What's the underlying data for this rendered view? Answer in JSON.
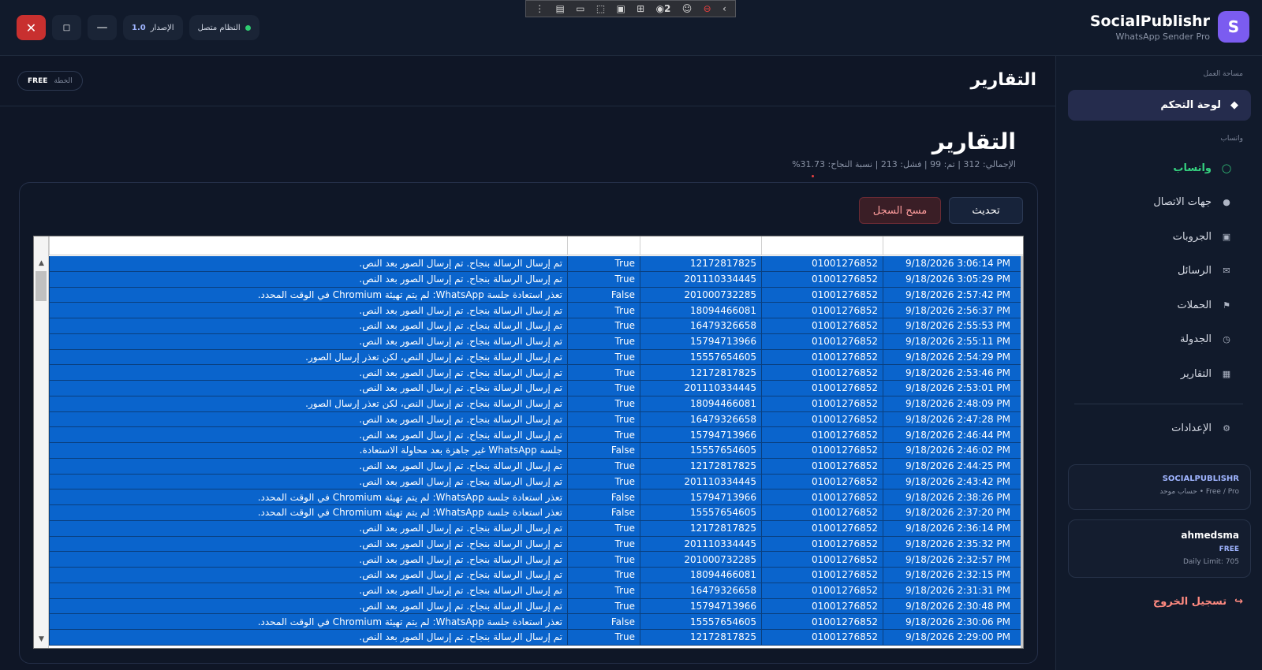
{
  "window": {
    "brand": {
      "logo_letter": "S",
      "name": "SocialPublishr",
      "subtitle": "WhatsApp Sender Pro"
    },
    "status_pill": "النظام متصل",
    "version_label": "الإصدار",
    "version_value": "1.0",
    "close_glyph": "✕",
    "maximize_glyph": "□",
    "minimize_glyph": "—"
  },
  "devtools": {
    "record_count": "2"
  },
  "sidebar": {
    "workspace_label": "مساحة العمل",
    "dashboard": "لوحة التحكم",
    "whatsapp_label": "واتساب",
    "items": [
      {
        "label": "واتساب",
        "icon": "chat-bubble-icon"
      },
      {
        "label": "جهات الاتصال",
        "icon": "info-circle-icon"
      },
      {
        "label": "الجروبات",
        "icon": "group-card-icon"
      },
      {
        "label": "الرسائل",
        "icon": "mail-icon"
      },
      {
        "label": "الحملات",
        "icon": "flag-icon"
      },
      {
        "label": "الجدولة",
        "icon": "clock-icon"
      },
      {
        "label": "التقارير",
        "icon": "bar-chart-icon"
      }
    ],
    "settings": "الإعدادات",
    "account_card": {
      "title": "SOCIALPUBLISHR",
      "subtitle": "حساب موحد • Free / Pro"
    },
    "user_card": {
      "username": "ahmedsma",
      "plan": "FREE",
      "limit": "Daily Limit: 705"
    },
    "logout": "تسجيل الخروج"
  },
  "header": {
    "title": "التقارير",
    "plan_label": "الخطة",
    "plan_value": "FREE"
  },
  "main": {
    "title": "التقارير",
    "summary": "الإجمالي: 312 | تم: 99 | فشل: 213 | نسبة النجاح: 31.73%",
    "refresh_button": "تحديث",
    "clear_button": "مسح السجل"
  },
  "log_rows": [
    {
      "date": "9/18/2026 3:06:14 PM",
      "sender": "01001276852",
      "receiver": "12172817825",
      "success": "True",
      "message": "تم إرسال الرسالة بنجاح. تم إرسال الصور بعد النص."
    },
    {
      "date": "9/18/2026 3:05:29 PM",
      "sender": "01001276852",
      "receiver": "201110334445",
      "success": "True",
      "message": "تم إرسال الرسالة بنجاح. تم إرسال الصور بعد النص."
    },
    {
      "date": "9/18/2026 2:57:42 PM",
      "sender": "01001276852",
      "receiver": "201000732285",
      "success": "False",
      "message": "تعذر استعادة جلسة WhatsApp: لم يتم تهيئة Chromium في الوقت المحدد."
    },
    {
      "date": "9/18/2026 2:56:37 PM",
      "sender": "01001276852",
      "receiver": "18094466081",
      "success": "True",
      "message": "تم إرسال الرسالة بنجاح. تم إرسال الصور بعد النص."
    },
    {
      "date": "9/18/2026 2:55:53 PM",
      "sender": "01001276852",
      "receiver": "16479326658",
      "success": "True",
      "message": "تم إرسال الرسالة بنجاح. تم إرسال الصور بعد النص."
    },
    {
      "date": "9/18/2026 2:55:11 PM",
      "sender": "01001276852",
      "receiver": "15794713966",
      "success": "True",
      "message": "تم إرسال الرسالة بنجاح. تم إرسال الصور بعد النص."
    },
    {
      "date": "9/18/2026 2:54:29 PM",
      "sender": "01001276852",
      "receiver": "15557654605",
      "success": "True",
      "message": "تم إرسال الرسالة بنجاح. تم إرسال النص، لكن تعذر إرسال الصور."
    },
    {
      "date": "9/18/2026 2:53:46 PM",
      "sender": "01001276852",
      "receiver": "12172817825",
      "success": "True",
      "message": "تم إرسال الرسالة بنجاح. تم إرسال الصور بعد النص."
    },
    {
      "date": "9/18/2026 2:53:01 PM",
      "sender": "01001276852",
      "receiver": "201110334445",
      "success": "True",
      "message": "تم إرسال الرسالة بنجاح. تم إرسال الصور بعد النص."
    },
    {
      "date": "9/18/2026 2:48:09 PM",
      "sender": "01001276852",
      "receiver": "18094466081",
      "success": "True",
      "message": "تم إرسال الرسالة بنجاح. تم إرسال النص، لكن تعذر إرسال الصور."
    },
    {
      "date": "9/18/2026 2:47:28 PM",
      "sender": "01001276852",
      "receiver": "16479326658",
      "success": "True",
      "message": "تم إرسال الرسالة بنجاح. تم إرسال الصور بعد النص."
    },
    {
      "date": "9/18/2026 2:46:44 PM",
      "sender": "01001276852",
      "receiver": "15794713966",
      "success": "True",
      "message": "تم إرسال الرسالة بنجاح. تم إرسال الصور بعد النص."
    },
    {
      "date": "9/18/2026 2:46:02 PM",
      "sender": "01001276852",
      "receiver": "15557654605",
      "success": "False",
      "message": "جلسة WhatsApp غير جاهزة بعد محاولة الاستعادة."
    },
    {
      "date": "9/18/2026 2:44:25 PM",
      "sender": "01001276852",
      "receiver": "12172817825",
      "success": "True",
      "message": "تم إرسال الرسالة بنجاح. تم إرسال الصور بعد النص."
    },
    {
      "date": "9/18/2026 2:43:42 PM",
      "sender": "01001276852",
      "receiver": "201110334445",
      "success": "True",
      "message": "تم إرسال الرسالة بنجاح. تم إرسال الصور بعد النص."
    },
    {
      "date": "9/18/2026 2:38:26 PM",
      "sender": "01001276852",
      "receiver": "15794713966",
      "success": "False",
      "message": "تعذر استعادة جلسة WhatsApp: لم يتم تهيئة Chromium في الوقت المحدد."
    },
    {
      "date": "9/18/2026 2:37:20 PM",
      "sender": "01001276852",
      "receiver": "15557654605",
      "success": "False",
      "message": "تعذر استعادة جلسة WhatsApp: لم يتم تهيئة Chromium في الوقت المحدد."
    },
    {
      "date": "9/18/2026 2:36:14 PM",
      "sender": "01001276852",
      "receiver": "12172817825",
      "success": "True",
      "message": "تم إرسال الرسالة بنجاح. تم إرسال الصور بعد النص."
    },
    {
      "date": "9/18/2026 2:35:32 PM",
      "sender": "01001276852",
      "receiver": "201110334445",
      "success": "True",
      "message": "تم إرسال الرسالة بنجاح. تم إرسال الصور بعد النص."
    },
    {
      "date": "9/18/2026 2:32:57 PM",
      "sender": "01001276852",
      "receiver": "201000732285",
      "success": "True",
      "message": "تم إرسال الرسالة بنجاح. تم إرسال الصور بعد النص."
    },
    {
      "date": "9/18/2026 2:32:15 PM",
      "sender": "01001276852",
      "receiver": "18094466081",
      "success": "True",
      "message": "تم إرسال الرسالة بنجاح. تم إرسال الصور بعد النص."
    },
    {
      "date": "9/18/2026 2:31:31 PM",
      "sender": "01001276852",
      "receiver": "16479326658",
      "success": "True",
      "message": "تم إرسال الرسالة بنجاح. تم إرسال الصور بعد النص."
    },
    {
      "date": "9/18/2026 2:30:48 PM",
      "sender": "01001276852",
      "receiver": "15794713966",
      "success": "True",
      "message": "تم إرسال الرسالة بنجاح. تم إرسال الصور بعد النص."
    },
    {
      "date": "9/18/2026 2:30:06 PM",
      "sender": "01001276852",
      "receiver": "15557654605",
      "success": "False",
      "message": "تعذر استعادة جلسة WhatsApp: لم يتم تهيئة Chromium في الوقت المحدد."
    },
    {
      "date": "9/18/2026 2:29:00 PM",
      "sender": "01001276852",
      "receiver": "12172817825",
      "success": "True",
      "message": "تم إرسال الرسالة بنجاح. تم إرسال الصور بعد النص."
    }
  ],
  "colors": {
    "accent": "#7b5cf0",
    "selection": "#0a64cc",
    "success": "#35d07f",
    "danger": "#c8302f"
  }
}
